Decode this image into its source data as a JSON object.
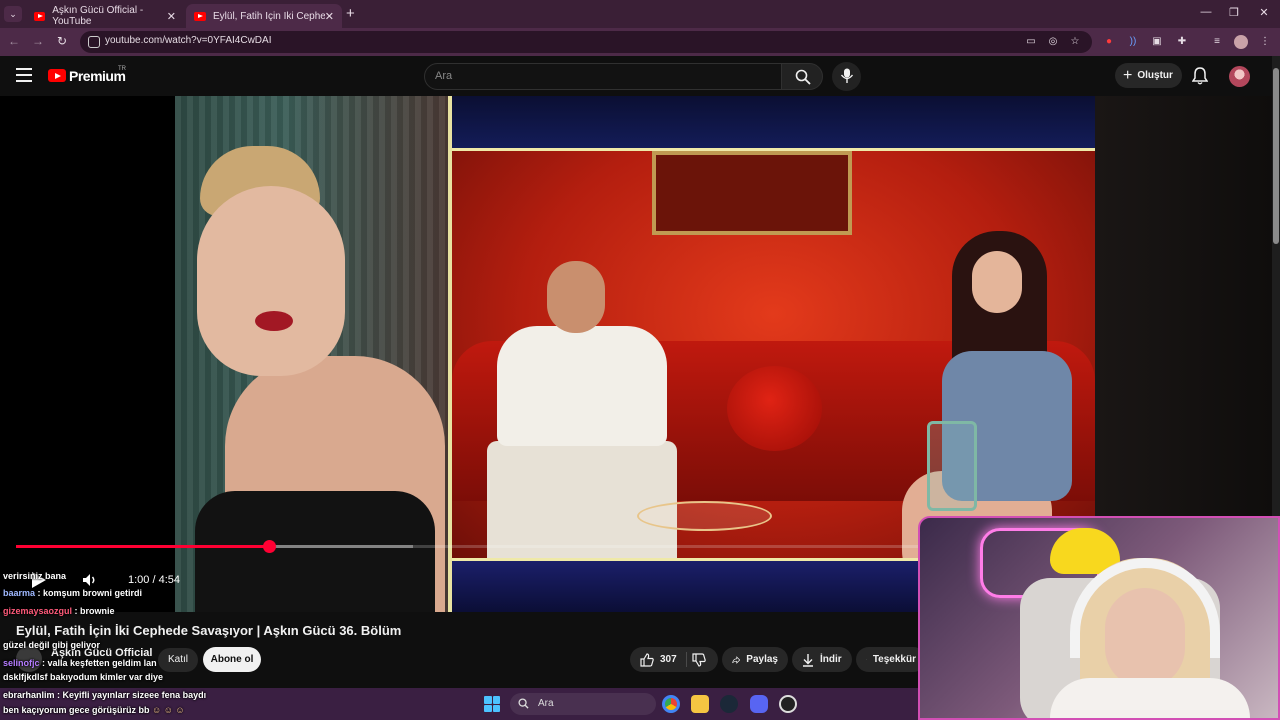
{
  "browser": {
    "tabs": [
      {
        "title": "Aşkın Gücü Official - YouTube",
        "active": false
      },
      {
        "title": "Eylül, Fatih İçin İki Cephede Sav",
        "active": true
      }
    ],
    "url": "youtube.com/watch?v=0YFAI4CwDAI"
  },
  "youtube": {
    "brand": "Premium",
    "country": "TR",
    "search_placeholder": "Ara",
    "create_label": "Oluştur"
  },
  "player": {
    "current_time": "1:00",
    "duration": "4:54",
    "time_display": "1:00 / 4:54",
    "progress_fraction": 0.204,
    "buffered_fraction": 0.32
  },
  "video": {
    "title": "Eylül, Fatih İçin İki Cephede Savaşıyor | Aşkın Gücü 36. Bölüm",
    "channel": "Aşkın Gücü Official",
    "subscribers": "",
    "join_label": "Katıl",
    "subscribe_label": "Abone ol",
    "likes": "307",
    "share_label": "Paylaş",
    "download_label": "İndir",
    "thanks_label": "Teşekkür"
  },
  "chat": [
    {
      "name": "",
      "text": "verirsiniz bana"
    },
    {
      "name": "baarma",
      "text": ": komşum browni getirdi"
    },
    {
      "name": "gizemaysaozgul",
      "text": ": brownie"
    },
    {
      "name": "",
      "text": "güzel değil gibi geliyor"
    },
    {
      "name": "selinofjc",
      "text": ": valla keşfetten geldim lan"
    },
    {
      "name": "",
      "text": "dsklfjkdlsf bakıyodum kimler var diye"
    },
    {
      "name": "ebrarhanlim",
      "text": ": Keyifli yayınlarr sizeee fena baydı"
    },
    {
      "name": "",
      "text": "ben kaçıyorum gece görüşürüz bb"
    }
  ],
  "taskbar": {
    "search_label": "Ara"
  },
  "colors": {
    "accent": "#ff0033",
    "tabstrip": "#3a1f36",
    "toolbar": "#4d2a48",
    "webcam_border": "#d24fb5"
  }
}
